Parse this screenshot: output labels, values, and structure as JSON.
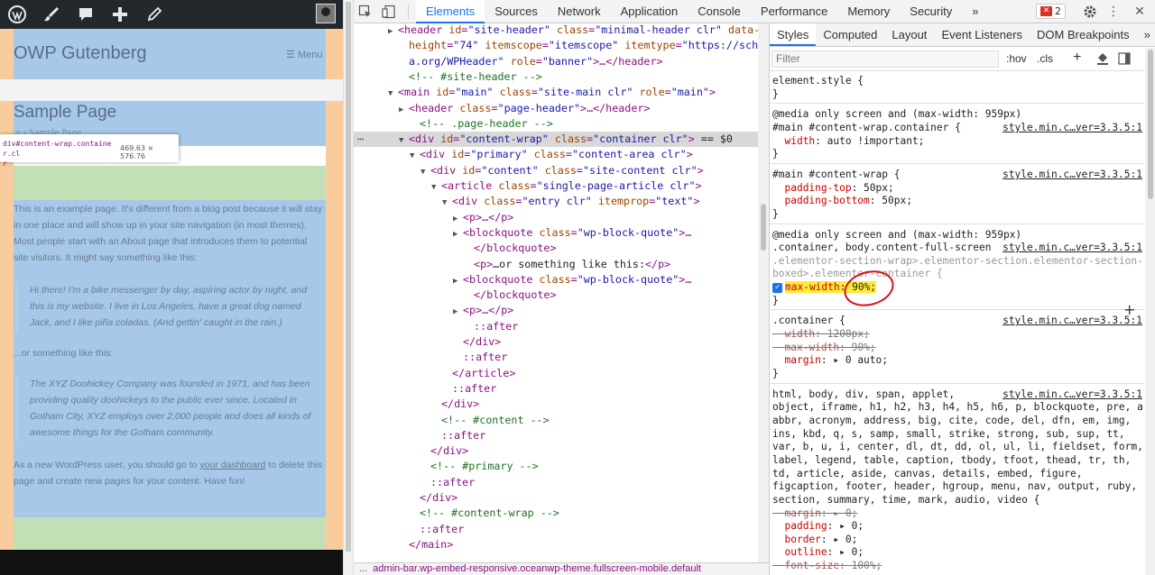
{
  "site": {
    "admin_icons": [
      "wordpress-icon",
      "customize-brush-icon",
      "comments-icon",
      "new-plus-icon",
      "edit-pencil-icon"
    ],
    "title": "OWP Gutenberg",
    "menu_label": "Menu",
    "page_title": "Sample Page",
    "breadcrumb": "Sample Page",
    "tooltip": {
      "selector": "div#content-wrap.container.cl",
      "selector_tail": "r",
      "size": "469.63 × 576.76"
    },
    "paragraphs": [
      "This is an example page. It's different from a blog post because it will stay in one place and will show up in your site navigation (in most themes). Most people start with an About page that introduces them to potential site visitors. It might say something like this:",
      "...or something like this:"
    ],
    "quotes": [
      "Hi there! I'm a bike messenger by day, aspiring actor by night, and this is my website. I live in Los Angeles, have a great dog named Jack, and I like piña coladas. (And gettin' caught in the rain.)",
      "The XYZ Doohickey Company was founded in 1971, and has been providing quality doohickeys to the public ever since. Located in Gotham City, XYZ employs over 2,000 people and does all kinds of awesome things for the Gotham community."
    ],
    "final_para_pre": "As a new WordPress user, you should go to ",
    "final_para_link": "your dashboard",
    "final_para_post": " to delete this page and create new pages for your content. Have fun!"
  },
  "devtools": {
    "tabs": [
      "Elements",
      "Sources",
      "Network",
      "Application",
      "Console",
      "Performance",
      "Memory",
      "Security"
    ],
    "more_tabs": "»",
    "error_count": "2",
    "error_x": "✕",
    "styles_tabs": [
      "Styles",
      "Computed",
      "Layout",
      "Event Listeners",
      "DOM Breakpoints"
    ],
    "styles_more": "»",
    "filter_placeholder": "Filter",
    "hov": ":hov",
    "cls": ".cls",
    "breadcrumb_prefix": "...",
    "breadcrumb": "admin-bar.wp-embed-responsive.oceanwp-theme.fullscreen-mobile.default"
  },
  "tree_lines": [
    {
      "indent": 4,
      "tri": "▶",
      "html": "<span class='t'>&lt;header</span> <span class='a'>id</span>=<span class='v'>\"site-header\"</span> <span class='a'>class</span>=<span class='v'>\"minimal-header clr\"</span> <span class='a'>data-</span>"
    },
    {
      "indent": 5,
      "tri": "",
      "html": "<span class='a'>height</span>=<span class='v'>\"74\"</span> <span class='a'>itemscope</span>=<span class='v'>\"itemscope\"</span> <span class='a'>itemtype</span>=<span class='v'>\"https://schem</span>"
    },
    {
      "indent": 5,
      "tri": "",
      "html": "<span class='v'>a.org/WPHeader\"</span> <span class='a'>role</span>=<span class='v'>\"banner\"</span>&gt;…<span class='t'>&lt;/header&gt;</span>"
    },
    {
      "indent": 5,
      "tri": "",
      "html": "<span class='c'>&lt;!-- #site-header --&gt;</span>"
    },
    {
      "indent": 4,
      "tri": "▼",
      "html": "<span class='t'>&lt;main</span> <span class='a'>id</span>=<span class='v'>\"main\"</span> <span class='a'>class</span>=<span class='v'>\"site-main clr\"</span> <span class='a'>role</span>=<span class='v'>\"main\"</span><span class='t'>&gt;</span>"
    },
    {
      "indent": 5,
      "tri": "▶",
      "html": "<span class='t'>&lt;header</span> <span class='a'>class</span>=<span class='v'>\"page-header\"</span>&gt;…<span class='t'>&lt;/header&gt;</span>"
    },
    {
      "indent": 6,
      "tri": "",
      "html": "<span class='c'>&lt;!-- .page-header --&gt;</span>"
    },
    {
      "indent": 5,
      "tri": "▼",
      "hl": true,
      "html": "<span class='t'>&lt;div</span> <span class='a'>id</span>=<span class='v'>\"content-wrap\"</span> <span class='a'>class</span>=<span class='v'>\"container clr\"</span><span class='t'>&gt;</span> <span class='p'>== $0</span>"
    },
    {
      "indent": 6,
      "tri": "▼",
      "html": "<span class='t'>&lt;div</span> <span class='a'>id</span>=<span class='v'>\"primary\"</span> <span class='a'>class</span>=<span class='v'>\"content-area clr\"</span><span class='t'>&gt;</span>"
    },
    {
      "indent": 7,
      "tri": "▼",
      "html": "<span class='t'>&lt;div</span> <span class='a'>id</span>=<span class='v'>\"content\"</span> <span class='a'>class</span>=<span class='v'>\"site-content clr\"</span><span class='t'>&gt;</span>"
    },
    {
      "indent": 8,
      "tri": "▼",
      "html": "<span class='t'>&lt;article</span> <span class='a'>class</span>=<span class='v'>\"single-page-article clr\"</span><span class='t'>&gt;</span>"
    },
    {
      "indent": 9,
      "tri": "▼",
      "html": "<span class='t'>&lt;div</span> <span class='a'>class</span>=<span class='v'>\"entry clr\"</span> <span class='a'>itemprop</span>=<span class='v'>\"text\"</span><span class='t'>&gt;</span>"
    },
    {
      "indent": 10,
      "tri": "▶",
      "html": "<span class='t'>&lt;p&gt;</span>…<span class='t'>&lt;/p&gt;</span>"
    },
    {
      "indent": 10,
      "tri": "▶",
      "html": "<span class='t'>&lt;blockquote</span> <span class='a'>class</span>=<span class='v'>\"wp-block-quote\"</span><span class='t'>&gt;</span>…"
    },
    {
      "indent": 11,
      "tri": "",
      "html": "<span class='t'>&lt;/blockquote&gt;</span>"
    },
    {
      "indent": 11,
      "tri": "",
      "html": "<span class='t'>&lt;p&gt;</span><span class='p'>…or something like this:</span><span class='t'>&lt;/p&gt;</span>"
    },
    {
      "indent": 10,
      "tri": "▶",
      "html": "<span class='t'>&lt;blockquote</span> <span class='a'>class</span>=<span class='v'>\"wp-block-quote\"</span><span class='t'>&gt;</span>…"
    },
    {
      "indent": 11,
      "tri": "",
      "html": "<span class='t'>&lt;/blockquote&gt;</span>"
    },
    {
      "indent": 10,
      "tri": "▶",
      "html": "<span class='t'>&lt;p&gt;</span>…<span class='t'>&lt;/p&gt;</span>"
    },
    {
      "indent": 11,
      "tri": "",
      "html": "<span class='t'>::after</span>"
    },
    {
      "indent": 10,
      "tri": "",
      "html": "<span class='t'>&lt;/div&gt;</span>"
    },
    {
      "indent": 10,
      "tri": "",
      "html": "<span class='t'>::after</span>"
    },
    {
      "indent": 9,
      "tri": "",
      "html": "<span class='t'>&lt;/article&gt;</span>"
    },
    {
      "indent": 9,
      "tri": "",
      "html": "<span class='t'>::after</span>"
    },
    {
      "indent": 8,
      "tri": "",
      "html": "<span class='t'>&lt;/div&gt;</span>"
    },
    {
      "indent": 8,
      "tri": "",
      "html": "<span class='c'>&lt;!-- #content --&gt;</span>"
    },
    {
      "indent": 8,
      "tri": "",
      "html": "<span class='t'>::after</span>"
    },
    {
      "indent": 7,
      "tri": "",
      "html": "<span class='t'>&lt;/div&gt;</span>"
    },
    {
      "indent": 7,
      "tri": "",
      "html": "<span class='c'>&lt;!-- #primary --&gt;</span>"
    },
    {
      "indent": 7,
      "tri": "",
      "html": "<span class='t'>::after</span>"
    },
    {
      "indent": 6,
      "tri": "",
      "html": "<span class='t'>&lt;/div&gt;</span>"
    },
    {
      "indent": 6,
      "tri": "",
      "html": "<span class='c'>&lt;!-- #content-wrap --&gt;</span>"
    },
    {
      "indent": 6,
      "tri": "",
      "html": "<span class='t'>::after</span>"
    },
    {
      "indent": 5,
      "tri": "",
      "html": "<span class='t'>&lt;/main&gt;</span>"
    }
  ],
  "styles": [
    {
      "text": "element.style {"
    },
    {
      "text": "}"
    },
    {
      "text": "@media only screen and (max-width: 959px)"
    },
    {
      "text": "#main #content-wrap.container {",
      "src": "style.min.c…ver=3.3.5:1"
    },
    {
      "text": "  width: auto !important;",
      "prop": "width"
    },
    {
      "text": "}"
    },
    {
      "text": "#main #content-wrap {",
      "src": "style.min.c…ver=3.3.5:1"
    },
    {
      "text": "  padding-top: 50px;",
      "prop": "padding-top"
    },
    {
      "text": "  padding-bottom: 50px;",
      "prop": "padding-bottom"
    },
    {
      "text": "}"
    },
    {
      "text": "@media only screen and (max-width: 959px)"
    },
    {
      "text": ".container, body.content-full-screen",
      "src": "style.min.c…ver=3.3.5:1"
    },
    {
      "text": ".elementor-section-wrap>.elementor-section.elementor-section-",
      "dim": true
    },
    {
      "text": "boxed>.elementor-container {",
      "dim": true
    },
    {
      "text": "max-width: 90%;",
      "checked": true
    },
    {
      "text": "}"
    },
    {
      "text": ".container {",
      "src": "style.min.c…ver=3.3.5:1"
    },
    {
      "text": "  width: 1200px;",
      "strike": true
    },
    {
      "text": "  max-width: 90%;",
      "strike": true
    },
    {
      "text": "  margin: ▸ 0 auto;",
      "prop": "margin"
    },
    {
      "text": "}"
    },
    {
      "text": "html, body, div, span, applet,",
      "src": "style.min.c…ver=3.3.5:1"
    },
    {
      "text": "object, iframe, h1, h2, h3, h4, h5, h6, p, blockquote, pre, a,"
    },
    {
      "text": "abbr, acronym, address, big, cite, code, del, dfn, em, img,"
    },
    {
      "text": "ins, kbd, q, s, samp, small, strike, strong, sub, sup, tt,"
    },
    {
      "text": "var, b, u, i, center, dl, dt, dd, ol, ul, li, fieldset, form,"
    },
    {
      "text": "label, legend, table, caption, tbody, tfoot, thead, tr, th,"
    },
    {
      "text": "td, article, aside, canvas, details, embed, figure,"
    },
    {
      "text": "figcaption, footer, header, hgroup, menu, nav, output, ruby,"
    },
    {
      "text": "section, summary, time, mark, audio, video {"
    },
    {
      "text": "  margin: ▸ 0;",
      "strike": true
    },
    {
      "text": "  padding: ▸ 0;",
      "prop": "padding"
    },
    {
      "text": "  border: ▸ 0;",
      "prop": "border"
    },
    {
      "text": "  outline: ▸ 0;",
      "prop": "outline"
    },
    {
      "text": "  font-size: 100%;",
      "strike": true
    }
  ]
}
